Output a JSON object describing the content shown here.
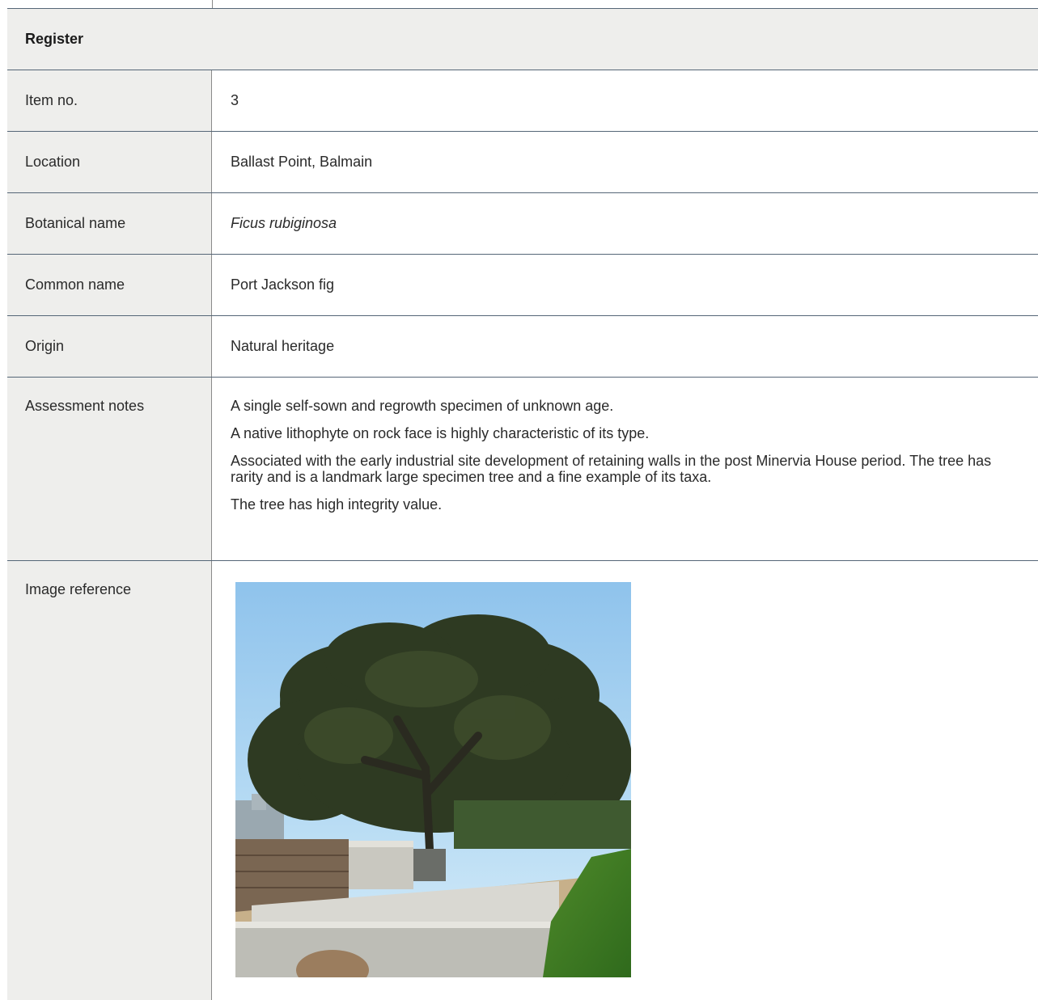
{
  "register": {
    "title": "Register",
    "rows": [
      {
        "label": "Item no.",
        "value": "3"
      },
      {
        "label": "Location",
        "value": "Ballast Point, Balmain"
      },
      {
        "label": "Botanical name",
        "value": "Ficus rubiginosa"
      },
      {
        "label": "Common name",
        "value": "Port Jackson fig"
      },
      {
        "label": "Origin",
        "value": "Natural heritage"
      }
    ],
    "assessment": {
      "label": "Assessment notes",
      "notes": [
        "A single self-sown and regrowth specimen of unknown age.",
        "A native lithophyte on rock face is highly characteristic of its type.",
        "Associated with the early industrial site development of retaining walls in the post Minervia House period. The tree has rarity and is a landmark large specimen tree and a fine example of its taxa.",
        "The tree has high integrity value."
      ]
    },
    "image_reference": {
      "label": "Image reference"
    }
  }
}
